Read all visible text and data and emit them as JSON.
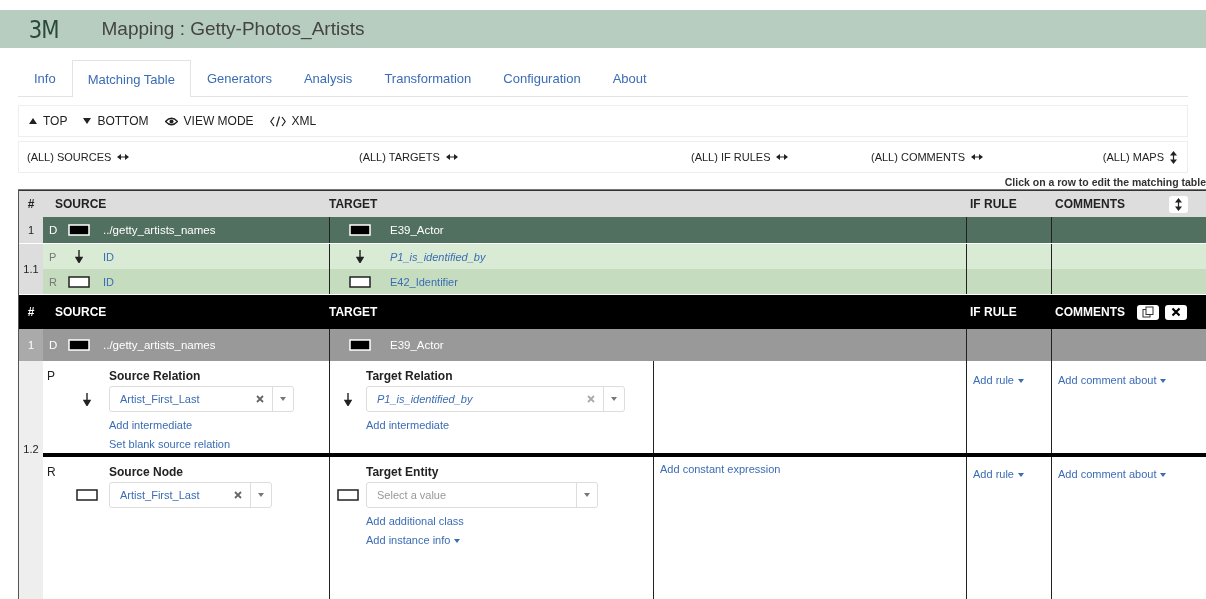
{
  "header": {
    "logo": "3M",
    "title": "Mapping : Getty-Photos_Artists"
  },
  "tabs": [
    {
      "label": "Info",
      "selected": false
    },
    {
      "label": "Matching Table",
      "selected": true
    },
    {
      "label": "Generators",
      "selected": false
    },
    {
      "label": "Analysis",
      "selected": false
    },
    {
      "label": "Transformation",
      "selected": false
    },
    {
      "label": "Configuration",
      "selected": false
    },
    {
      "label": "About",
      "selected": false
    }
  ],
  "toolbar": [
    {
      "label": "TOP",
      "kind": "top"
    },
    {
      "label": "BOTTOM",
      "kind": "bottom"
    },
    {
      "label": "VIEW MODE",
      "kind": "view"
    },
    {
      "label": "XML",
      "kind": "xml"
    }
  ],
  "toggles": [
    {
      "label": "(ALL) SOURCES",
      "kind": "horizontal"
    },
    {
      "label": "(ALL) TARGETS",
      "kind": "horizontal"
    },
    {
      "label": "(ALL) IF RULES",
      "kind": "horizontal"
    },
    {
      "label": "(ALL) COMMENTS",
      "kind": "horizontal"
    },
    {
      "label": "(ALL) MAPS",
      "kind": "vertical"
    }
  ],
  "hint": "Click on a row to edit the matching table",
  "table": {
    "columns": [
      "#",
      "SOURCE",
      "TARGET",
      "IF RULE",
      "COMMENTS"
    ],
    "rows": [
      {
        "number": "1",
        "kind": "domain",
        "lines": [
          {
            "letter": "D",
            "kind": "domain",
            "source": "../getty_artists_names",
            "target": "E39_Actor"
          }
        ]
      },
      {
        "number": "1.1",
        "kind": "link",
        "lines": [
          {
            "letter": "P",
            "kind": "relation",
            "source": "ID",
            "target": "P1_is_identified_by"
          },
          {
            "letter": "R",
            "kind": "range",
            "source": "ID",
            "target": "E42_Identifier"
          }
        ]
      }
    ]
  },
  "editor": {
    "columns": [
      "#",
      "SOURCE",
      "TARGET",
      "IF RULE",
      "COMMENTS"
    ],
    "domain": {
      "number": "1",
      "letter": "D",
      "source": "../getty_artists_names",
      "target": "E39_Actor"
    },
    "number": "1.2",
    "path": {
      "letter": "P",
      "source_label": "Source Relation",
      "source_value": "Artist_First_Last",
      "source_links": [
        "Add intermediate",
        "Set blank source relation"
      ],
      "target_label": "Target Relation",
      "target_value": "P1_is_identified_by",
      "target_links": [
        {
          "label": "Add intermediate",
          "dropdown": false
        }
      ],
      "rule": "Add rule",
      "comment": "Add comment about"
    },
    "range": {
      "letter": "R",
      "source_label": "Source Node",
      "source_value": "Artist_First_Last",
      "target_label": "Target Entity",
      "target_placeholder": "Select a value",
      "target_links": [
        {
          "label": "Add additional class",
          "dropdown": false
        },
        {
          "label": "Add instance info",
          "dropdown": true
        }
      ],
      "constant": "Add constant expression",
      "rule": "Add rule",
      "comment": "Add comment about"
    }
  }
}
